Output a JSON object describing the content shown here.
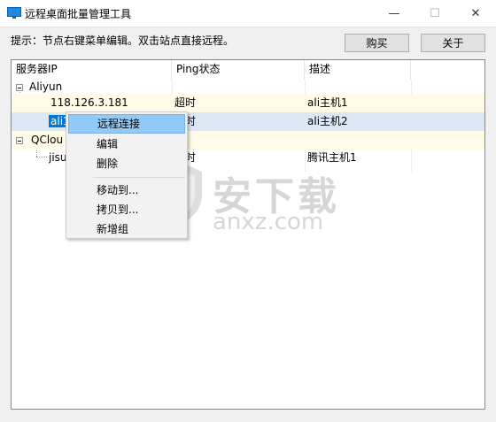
{
  "window": {
    "title": "远程桌面批量管理工具",
    "minimize_glyph": "—",
    "maximize_glyph": "☐",
    "close_glyph": "✕"
  },
  "toolbar": {
    "hint": "提示：节点右键菜单编辑。双击站点直接远程。",
    "buy_label": "购买",
    "about_label": "关于"
  },
  "columns": [
    "服务器IP",
    "Ping状态",
    "描述"
  ],
  "groups": [
    {
      "name": "Aliyun",
      "servers": [
        {
          "ip": "118.126.3.181",
          "ping": "超时",
          "desc": "ali主机1"
        },
        {
          "ip": "ali1",
          "ping": "超时",
          "desc": "ali主机2"
        }
      ]
    },
    {
      "name": "QCloud",
      "servers": [
        {
          "ip": "jisu",
          "ping": "超时",
          "desc": "腾讯主机1"
        }
      ]
    }
  ],
  "visible_fragments": {
    "row2_ip": "ali1",
    "row2_ping": "时",
    "group2_name": "QClou",
    "row4_ip": "jisu",
    "row4_ping": "时"
  },
  "context_menu": {
    "items": [
      "远程连接",
      "编辑",
      "删除",
      "移动到...",
      "拷贝到...",
      "新增组"
    ],
    "active_index": 0
  },
  "watermark": {
    "text_cn": "安下载",
    "text_en": "anxz.com"
  },
  "colors": {
    "selection": "#0078d7",
    "row_highlight": "#fffbe6",
    "menu_active": "#91c9f7"
  }
}
